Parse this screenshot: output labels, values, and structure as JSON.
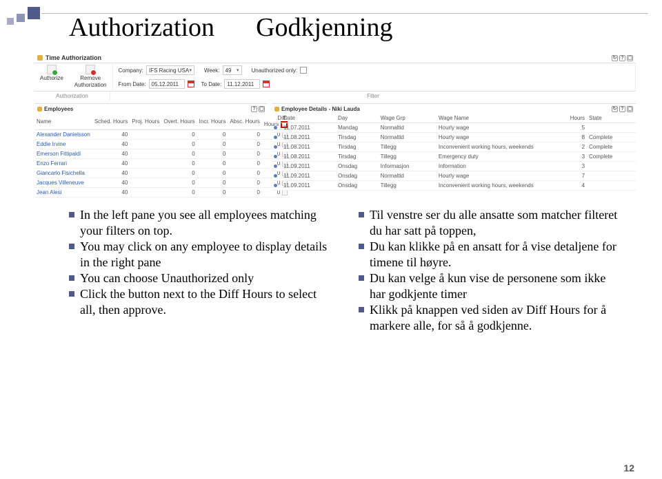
{
  "heading": {
    "left": "Authorization",
    "right": "Godkjenning"
  },
  "page_number": "12",
  "app": {
    "title": "Time Authorization",
    "toolbar": {
      "authorize": "Authorize",
      "remove_line1": "Remove",
      "remove_line2": "Authorization",
      "authorization_group": "Authorization",
      "filter_group": "Filter",
      "company_label": "Company:",
      "company_value": "IFS Racing USA",
      "week_label": "Week:",
      "week_value": "49",
      "unauth_label": "Unauthorized only:",
      "from_label": "From Date:",
      "from_value": "05.12.2011",
      "to_label": "To Date:",
      "to_value": "11.12.2011"
    },
    "employees_panel": {
      "title": "Employees",
      "headers": [
        "Name",
        "Sched. Hours",
        "Proj. Hours",
        "Overt. Hours",
        "Incr. Hours",
        "Absc. Hours",
        "Diff."
      ],
      "diff_hours_label": "Hours",
      "rows": [
        {
          "name": "Alexander Danielsson",
          "sched": "40",
          "proj": "",
          "overt": "0",
          "incr": "0",
          "absc": "0",
          "diff": "0"
        },
        {
          "name": "Eddie Irvine",
          "sched": "40",
          "proj": "",
          "overt": "0",
          "incr": "0",
          "absc": "0",
          "diff": "0"
        },
        {
          "name": "Emerson Fittipaldi",
          "sched": "40",
          "proj": "",
          "overt": "0",
          "incr": "0",
          "absc": "0",
          "diff": "0"
        },
        {
          "name": "Enzo Ferrari",
          "sched": "40",
          "proj": "",
          "overt": "0",
          "incr": "0",
          "absc": "0",
          "diff": "0"
        },
        {
          "name": "Giancarlo Fisichella",
          "sched": "40",
          "proj": "",
          "overt": "0",
          "incr": "0",
          "absc": "0",
          "diff": "0"
        },
        {
          "name": "Jacques Villeneuve",
          "sched": "40",
          "proj": "",
          "overt": "0",
          "incr": "0",
          "absc": "0",
          "diff": "0"
        },
        {
          "name": "Jean Alesi",
          "sched": "40",
          "proj": "",
          "overt": "0",
          "incr": "0",
          "absc": "0",
          "diff": "0"
        }
      ]
    },
    "details_panel": {
      "title": "Employee Details - Niki Lauda",
      "headers": [
        "Date",
        "Day",
        "Wage Grp",
        "Wage Name",
        "Hours",
        "State"
      ],
      "rows": [
        {
          "date": "11.07.2011",
          "day": "Mandag",
          "grp": "Normaltid",
          "wname": "Hourly wage",
          "hours": "5",
          "state": ""
        },
        {
          "date": "11.08.2011",
          "day": "Tirsdag",
          "grp": "Normaltid",
          "wname": "Hourly wage",
          "hours": "8",
          "state": "Complete"
        },
        {
          "date": "11.08.2011",
          "day": "Tirsdag",
          "grp": "Tillegg",
          "wname": "Inconvenient working hours, weekends",
          "hours": "2",
          "state": "Complete"
        },
        {
          "date": "11.08.2011",
          "day": "Tirsdag",
          "grp": "Tillegg",
          "wname": "Emergency duty",
          "hours": "3",
          "state": "Complete"
        },
        {
          "date": "11.09.2011",
          "day": "Onsdag",
          "grp": "Informasjon",
          "wname": "Information",
          "hours": "3",
          "state": ""
        },
        {
          "date": "11.09.2011",
          "day": "Onsdag",
          "grp": "Normaltid",
          "wname": "Hourly wage",
          "hours": "7",
          "state": ""
        },
        {
          "date": "11.09.2011",
          "day": "Onsdag",
          "grp": "Tillegg",
          "wname": "Inconvenient working hours, weekends",
          "hours": "4",
          "state": ""
        }
      ]
    }
  },
  "bullets": {
    "en": [
      "In the left pane you see all employees matching your filters on top.",
      "You may click on any employee to display details in the right pane",
      "You can choose Unauthorized only",
      "Click the button next to the Diff Hours to select all, then approve."
    ],
    "no": [
      "Til venstre ser du alle ansatte som matcher filteret du har satt på toppen,",
      "Du kan klikke på en ansatt for å vise detaljene for timene til høyre.",
      "Du kan velge å kun vise de personene som ikke har godkjente timer",
      "Klikk på knappen ved siden av Diff Hours for å markere alle, for så å godkjenne."
    ]
  }
}
